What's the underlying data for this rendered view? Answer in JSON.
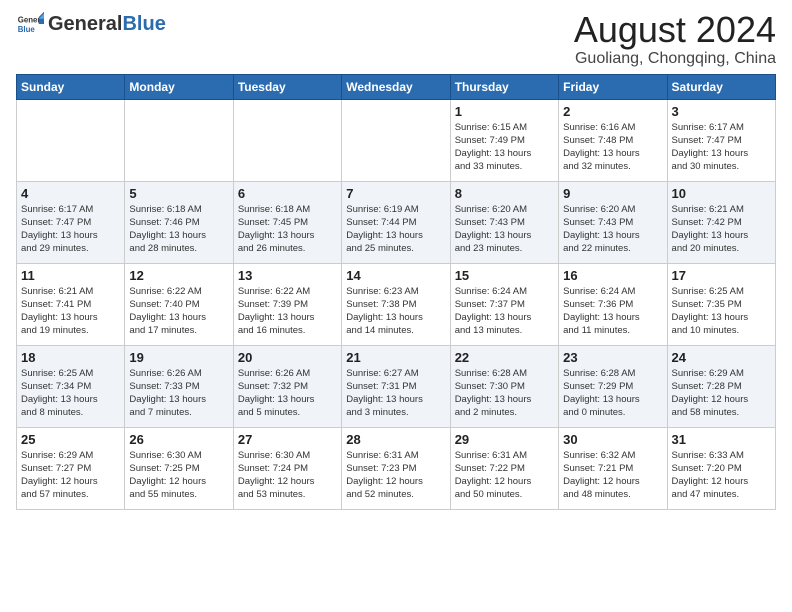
{
  "logo": {
    "text_general": "General",
    "text_blue": "Blue"
  },
  "title": {
    "month_year": "August 2024",
    "location": "Guoliang, Chongqing, China"
  },
  "days_of_week": [
    "Sunday",
    "Monday",
    "Tuesday",
    "Wednesday",
    "Thursday",
    "Friday",
    "Saturday"
  ],
  "weeks": [
    [
      {
        "day": "",
        "info": ""
      },
      {
        "day": "",
        "info": ""
      },
      {
        "day": "",
        "info": ""
      },
      {
        "day": "",
        "info": ""
      },
      {
        "day": "1",
        "info": "Sunrise: 6:15 AM\nSunset: 7:49 PM\nDaylight: 13 hours\nand 33 minutes."
      },
      {
        "day": "2",
        "info": "Sunrise: 6:16 AM\nSunset: 7:48 PM\nDaylight: 13 hours\nand 32 minutes."
      },
      {
        "day": "3",
        "info": "Sunrise: 6:17 AM\nSunset: 7:47 PM\nDaylight: 13 hours\nand 30 minutes."
      }
    ],
    [
      {
        "day": "4",
        "info": "Sunrise: 6:17 AM\nSunset: 7:47 PM\nDaylight: 13 hours\nand 29 minutes."
      },
      {
        "day": "5",
        "info": "Sunrise: 6:18 AM\nSunset: 7:46 PM\nDaylight: 13 hours\nand 28 minutes."
      },
      {
        "day": "6",
        "info": "Sunrise: 6:18 AM\nSunset: 7:45 PM\nDaylight: 13 hours\nand 26 minutes."
      },
      {
        "day": "7",
        "info": "Sunrise: 6:19 AM\nSunset: 7:44 PM\nDaylight: 13 hours\nand 25 minutes."
      },
      {
        "day": "8",
        "info": "Sunrise: 6:20 AM\nSunset: 7:43 PM\nDaylight: 13 hours\nand 23 minutes."
      },
      {
        "day": "9",
        "info": "Sunrise: 6:20 AM\nSunset: 7:43 PM\nDaylight: 13 hours\nand 22 minutes."
      },
      {
        "day": "10",
        "info": "Sunrise: 6:21 AM\nSunset: 7:42 PM\nDaylight: 13 hours\nand 20 minutes."
      }
    ],
    [
      {
        "day": "11",
        "info": "Sunrise: 6:21 AM\nSunset: 7:41 PM\nDaylight: 13 hours\nand 19 minutes."
      },
      {
        "day": "12",
        "info": "Sunrise: 6:22 AM\nSunset: 7:40 PM\nDaylight: 13 hours\nand 17 minutes."
      },
      {
        "day": "13",
        "info": "Sunrise: 6:22 AM\nSunset: 7:39 PM\nDaylight: 13 hours\nand 16 minutes."
      },
      {
        "day": "14",
        "info": "Sunrise: 6:23 AM\nSunset: 7:38 PM\nDaylight: 13 hours\nand 14 minutes."
      },
      {
        "day": "15",
        "info": "Sunrise: 6:24 AM\nSunset: 7:37 PM\nDaylight: 13 hours\nand 13 minutes."
      },
      {
        "day": "16",
        "info": "Sunrise: 6:24 AM\nSunset: 7:36 PM\nDaylight: 13 hours\nand 11 minutes."
      },
      {
        "day": "17",
        "info": "Sunrise: 6:25 AM\nSunset: 7:35 PM\nDaylight: 13 hours\nand 10 minutes."
      }
    ],
    [
      {
        "day": "18",
        "info": "Sunrise: 6:25 AM\nSunset: 7:34 PM\nDaylight: 13 hours\nand 8 minutes."
      },
      {
        "day": "19",
        "info": "Sunrise: 6:26 AM\nSunset: 7:33 PM\nDaylight: 13 hours\nand 7 minutes."
      },
      {
        "day": "20",
        "info": "Sunrise: 6:26 AM\nSunset: 7:32 PM\nDaylight: 13 hours\nand 5 minutes."
      },
      {
        "day": "21",
        "info": "Sunrise: 6:27 AM\nSunset: 7:31 PM\nDaylight: 13 hours\nand 3 minutes."
      },
      {
        "day": "22",
        "info": "Sunrise: 6:28 AM\nSunset: 7:30 PM\nDaylight: 13 hours\nand 2 minutes."
      },
      {
        "day": "23",
        "info": "Sunrise: 6:28 AM\nSunset: 7:29 PM\nDaylight: 13 hours\nand 0 minutes."
      },
      {
        "day": "24",
        "info": "Sunrise: 6:29 AM\nSunset: 7:28 PM\nDaylight: 12 hours\nand 58 minutes."
      }
    ],
    [
      {
        "day": "25",
        "info": "Sunrise: 6:29 AM\nSunset: 7:27 PM\nDaylight: 12 hours\nand 57 minutes."
      },
      {
        "day": "26",
        "info": "Sunrise: 6:30 AM\nSunset: 7:25 PM\nDaylight: 12 hours\nand 55 minutes."
      },
      {
        "day": "27",
        "info": "Sunrise: 6:30 AM\nSunset: 7:24 PM\nDaylight: 12 hours\nand 53 minutes."
      },
      {
        "day": "28",
        "info": "Sunrise: 6:31 AM\nSunset: 7:23 PM\nDaylight: 12 hours\nand 52 minutes."
      },
      {
        "day": "29",
        "info": "Sunrise: 6:31 AM\nSunset: 7:22 PM\nDaylight: 12 hours\nand 50 minutes."
      },
      {
        "day": "30",
        "info": "Sunrise: 6:32 AM\nSunset: 7:21 PM\nDaylight: 12 hours\nand 48 minutes."
      },
      {
        "day": "31",
        "info": "Sunrise: 6:33 AM\nSunset: 7:20 PM\nDaylight: 12 hours\nand 47 minutes."
      }
    ]
  ]
}
